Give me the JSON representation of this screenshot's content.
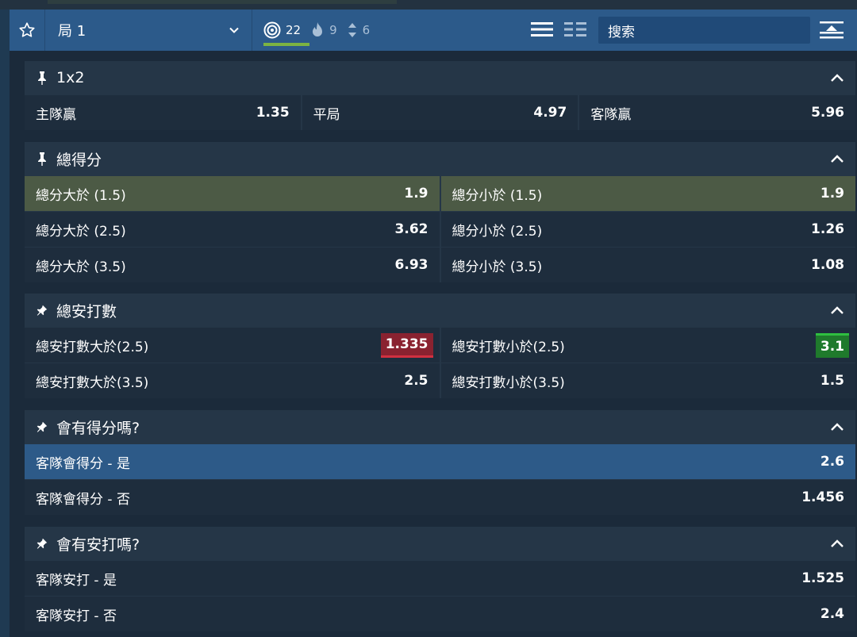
{
  "header": {
    "game_label": "局 1",
    "stats": [
      {
        "icon": "target-icon",
        "value": "22"
      },
      {
        "icon": "flame-icon",
        "value": "9"
      },
      {
        "icon": "sort-arrows-icon",
        "value": "6"
      }
    ],
    "search_placeholder": "搜索"
  },
  "markets": [
    {
      "title": "1x2",
      "rows": [
        [
          {
            "label": "主隊贏",
            "odds": "1.35"
          },
          {
            "label": "平局",
            "odds": "4.97"
          },
          {
            "label": "客隊贏",
            "odds": "5.96"
          }
        ]
      ]
    },
    {
      "title": "總得分",
      "rows": [
        [
          {
            "label": "總分大於 (1.5)",
            "odds": "1.9"
          },
          {
            "label": "總分小於 (1.5)",
            "odds": "1.9"
          }
        ],
        [
          {
            "label": "總分大於 (2.5)",
            "odds": "3.62"
          },
          {
            "label": "總分小於 (2.5)",
            "odds": "1.26"
          }
        ],
        [
          {
            "label": "總分大於 (3.5)",
            "odds": "6.93"
          },
          {
            "label": "總分小於 (3.5)",
            "odds": "1.08"
          }
        ]
      ]
    },
    {
      "title": "總安打數",
      "rows": [
        [
          {
            "label": "總安打數大於(2.5)",
            "odds": "1.335"
          },
          {
            "label": "總安打數小於(2.5)",
            "odds": "3.1"
          }
        ],
        [
          {
            "label": "總安打數大於(3.5)",
            "odds": "2.5"
          },
          {
            "label": "總安打數小於(3.5)",
            "odds": "1.5"
          }
        ]
      ]
    },
    {
      "title": "會有得分嗎?",
      "rows": [
        [
          {
            "label": "客隊會得分 - 是",
            "odds": "2.6"
          }
        ],
        [
          {
            "label": "客隊會得分 - 否",
            "odds": "1.456"
          }
        ]
      ]
    },
    {
      "title": "會有安打嗎?",
      "rows": [
        [
          {
            "label": "客隊安打 - 是",
            "odds": "1.525"
          }
        ],
        [
          {
            "label": "客隊安打 - 否",
            "odds": "2.4"
          }
        ]
      ]
    }
  ],
  "colors": {
    "header_bg": "#2c5a8a",
    "odds_down": "#8a2230",
    "odds_up": "#1f7a2c",
    "selected_green": "#4c5a45",
    "selected_blue": "#2d5a88"
  }
}
